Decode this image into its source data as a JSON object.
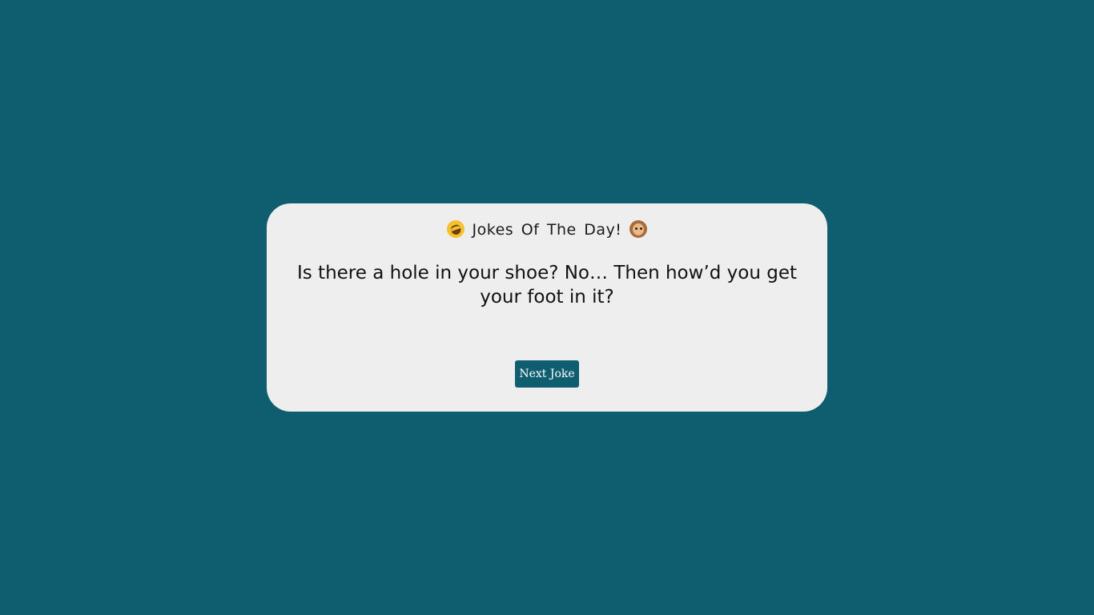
{
  "header": {
    "title": "Jokes Of The Day!",
    "left_icon": "rolling-laughing-emoji",
    "right_icon": "monkey-face-emoji"
  },
  "joke": {
    "text": "Is there a hole in your shoe? No… Then how’d you get your foot in it?"
  },
  "controls": {
    "next_label": "Next Joke"
  },
  "colors": {
    "background": "#0f5e70",
    "card": "#eeeeee",
    "button": "#0f5e70",
    "button_text": "#ffffff"
  }
}
